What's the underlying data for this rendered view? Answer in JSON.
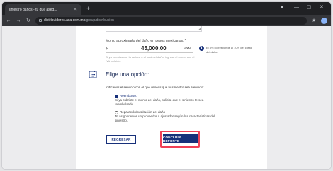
{
  "browser": {
    "tab_title": "siniestro daños - tu que aseg...",
    "tab_close": "×",
    "new_tab": "+",
    "url_domain": "distribuidores.axa.com.mx",
    "url_path": "/group/distribucion"
  },
  "form": {
    "amount_label": "Monto aproximado del daño en pesos mexicanos: *",
    "currency_symbol": "$",
    "amount_value": "45,000.00",
    "currency_code": "MXN",
    "amount_hint": "Si ya cuentas con la factura o el total del daño, ingresa el monto con el IVA incluido.",
    "info_text": "El 3% corresponde al 10% del costo del daño.",
    "section_title": "Elige una opción:",
    "section_intro": "Indícanos el servicio con el que deseas que tu siniestro sea atendido:",
    "options": [
      {
        "title": "Reembolso:",
        "description": "Si ya cubriste el monto del daño, solicita que el siniestro te sea reembolsado.",
        "selected": true
      },
      {
        "title": "Reparación/sustitución del daño",
        "description": "Te asignaremos un proveedor a ajustador según las características del siniestro.",
        "selected": false
      }
    ],
    "back_button": "REGRESAR",
    "finish_button": "CONCLUIR REPORTE"
  },
  "colors": {
    "primary": "#17307a",
    "highlight": "#f04056",
    "browser_chrome": "#202124"
  }
}
